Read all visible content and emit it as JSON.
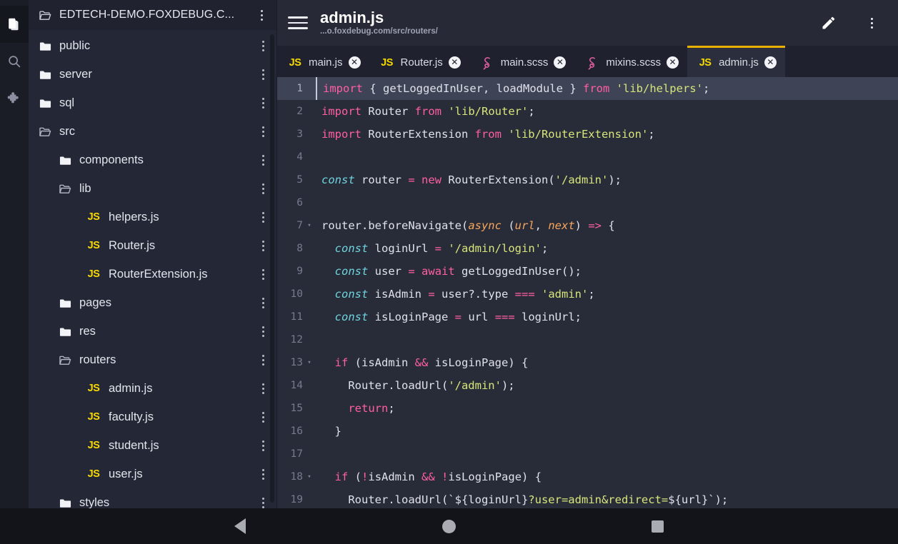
{
  "activity_bar": {
    "items": [
      {
        "name": "files-icon",
        "label": "Files",
        "active": true
      },
      {
        "name": "search-icon",
        "label": "Search",
        "active": false
      },
      {
        "name": "extensions-icon",
        "label": "Extensions",
        "active": false
      }
    ]
  },
  "explorer": {
    "project_name": "EDTECH-DEMO.FOXDEBUG.C...",
    "tree": [
      {
        "label": "public",
        "type": "folder",
        "depth": 1
      },
      {
        "label": "server",
        "type": "folder",
        "depth": 1
      },
      {
        "label": "sql",
        "type": "folder",
        "depth": 1
      },
      {
        "label": "src",
        "type": "folder-open",
        "depth": 1
      },
      {
        "label": "components",
        "type": "folder",
        "depth": 2
      },
      {
        "label": "lib",
        "type": "folder-open",
        "depth": 2
      },
      {
        "label": "helpers.js",
        "type": "js",
        "depth": 3
      },
      {
        "label": "Router.js",
        "type": "js",
        "depth": 3
      },
      {
        "label": "RouterExtension.js",
        "type": "js",
        "depth": 3
      },
      {
        "label": "pages",
        "type": "folder",
        "depth": 2
      },
      {
        "label": "res",
        "type": "folder",
        "depth": 2
      },
      {
        "label": "routers",
        "type": "folder-open",
        "depth": 2
      },
      {
        "label": "admin.js",
        "type": "js",
        "depth": 3
      },
      {
        "label": "faculty.js",
        "type": "js",
        "depth": 3
      },
      {
        "label": "student.js",
        "type": "js",
        "depth": 3
      },
      {
        "label": "user.js",
        "type": "js",
        "depth": 3
      },
      {
        "label": "styles",
        "type": "folder",
        "depth": 2
      }
    ]
  },
  "header": {
    "menu_icon": "hamburger-icon",
    "file_name": "admin.js",
    "file_path": "...o.foxdebug.com/src/routers/",
    "edit_icon": "pencil-icon",
    "overflow_icon": "more-vertical-icon"
  },
  "tabs": [
    {
      "label": "main.js",
      "icon": "js",
      "active": false,
      "close": "✕"
    },
    {
      "label": "Router.js",
      "icon": "js",
      "active": false,
      "close": "✕"
    },
    {
      "label": "main.scss",
      "icon": "scss",
      "active": false,
      "close": "✕"
    },
    {
      "label": "mixins.scss",
      "icon": "scss",
      "active": false,
      "close": "✕"
    },
    {
      "label": "admin.js",
      "icon": "js",
      "active": true,
      "close": "✕"
    }
  ],
  "editor": {
    "active_line": 1,
    "lines": [
      {
        "n": "1",
        "fold": "",
        "cur": true,
        "tokens": [
          {
            "t": "import",
            "c": "k"
          },
          {
            "t": " { ",
            "c": "pl"
          },
          {
            "t": "getLoggedInUser",
            "c": "id"
          },
          {
            "t": ", ",
            "c": "pl"
          },
          {
            "t": "loadModule",
            "c": "id"
          },
          {
            "t": " } ",
            "c": "pl"
          },
          {
            "t": "from",
            "c": "k"
          },
          {
            "t": " ",
            "c": "pl"
          },
          {
            "t": "'lib/helpers'",
            "c": "str"
          },
          {
            "t": ";",
            "c": "pl"
          }
        ]
      },
      {
        "n": "2",
        "fold": "",
        "cur": false,
        "tokens": [
          {
            "t": "import",
            "c": "k"
          },
          {
            "t": " Router ",
            "c": "id"
          },
          {
            "t": "from",
            "c": "k"
          },
          {
            "t": " ",
            "c": "pl"
          },
          {
            "t": "'lib/Router'",
            "c": "str"
          },
          {
            "t": ";",
            "c": "pl"
          }
        ]
      },
      {
        "n": "3",
        "fold": "",
        "cur": false,
        "tokens": [
          {
            "t": "import",
            "c": "k"
          },
          {
            "t": " RouterExtension ",
            "c": "id"
          },
          {
            "t": "from",
            "c": "k"
          },
          {
            "t": " ",
            "c": "pl"
          },
          {
            "t": "'lib/RouterExtension'",
            "c": "str"
          },
          {
            "t": ";",
            "c": "pl"
          }
        ]
      },
      {
        "n": "4",
        "fold": "",
        "cur": false,
        "tokens": []
      },
      {
        "n": "5",
        "fold": "",
        "cur": false,
        "tokens": [
          {
            "t": "const",
            "c": "kw2"
          },
          {
            "t": " router ",
            "c": "id"
          },
          {
            "t": "=",
            "c": "op"
          },
          {
            "t": " ",
            "c": "pl"
          },
          {
            "t": "new",
            "c": "k"
          },
          {
            "t": " RouterExtension(",
            "c": "id"
          },
          {
            "t": "'/admin'",
            "c": "str"
          },
          {
            "t": ");",
            "c": "pl"
          }
        ]
      },
      {
        "n": "6",
        "fold": "",
        "cur": false,
        "tokens": []
      },
      {
        "n": "7",
        "fold": "▾",
        "cur": false,
        "tokens": [
          {
            "t": "router.beforeNavigate(",
            "c": "id"
          },
          {
            "t": "async",
            "c": "par"
          },
          {
            "t": " (",
            "c": "pl"
          },
          {
            "t": "url",
            "c": "par"
          },
          {
            "t": ", ",
            "c": "pl"
          },
          {
            "t": "next",
            "c": "par"
          },
          {
            "t": ") ",
            "c": "pl"
          },
          {
            "t": "=>",
            "c": "op"
          },
          {
            "t": " {",
            "c": "pl"
          }
        ]
      },
      {
        "n": "8",
        "fold": "",
        "cur": false,
        "tokens": [
          {
            "t": "  ",
            "c": "pl"
          },
          {
            "t": "const",
            "c": "kw2"
          },
          {
            "t": " loginUrl ",
            "c": "id"
          },
          {
            "t": "=",
            "c": "op"
          },
          {
            "t": " ",
            "c": "pl"
          },
          {
            "t": "'/admin/login'",
            "c": "str"
          },
          {
            "t": ";",
            "c": "pl"
          }
        ]
      },
      {
        "n": "9",
        "fold": "",
        "cur": false,
        "tokens": [
          {
            "t": "  ",
            "c": "pl"
          },
          {
            "t": "const",
            "c": "kw2"
          },
          {
            "t": " user ",
            "c": "id"
          },
          {
            "t": "=",
            "c": "op"
          },
          {
            "t": " ",
            "c": "pl"
          },
          {
            "t": "await",
            "c": "k"
          },
          {
            "t": " getLoggedInUser();",
            "c": "id"
          }
        ]
      },
      {
        "n": "10",
        "fold": "",
        "cur": false,
        "tokens": [
          {
            "t": "  ",
            "c": "pl"
          },
          {
            "t": "const",
            "c": "kw2"
          },
          {
            "t": " isAdmin ",
            "c": "id"
          },
          {
            "t": "=",
            "c": "op"
          },
          {
            "t": " user?.type ",
            "c": "id"
          },
          {
            "t": "===",
            "c": "op"
          },
          {
            "t": " ",
            "c": "pl"
          },
          {
            "t": "'admin'",
            "c": "str"
          },
          {
            "t": ";",
            "c": "pl"
          }
        ]
      },
      {
        "n": "11",
        "fold": "",
        "cur": false,
        "tokens": [
          {
            "t": "  ",
            "c": "pl"
          },
          {
            "t": "const",
            "c": "kw2"
          },
          {
            "t": " isLoginPage ",
            "c": "id"
          },
          {
            "t": "=",
            "c": "op"
          },
          {
            "t": " url ",
            "c": "id"
          },
          {
            "t": "===",
            "c": "op"
          },
          {
            "t": " loginUrl;",
            "c": "id"
          }
        ]
      },
      {
        "n": "12",
        "fold": "",
        "cur": false,
        "tokens": []
      },
      {
        "n": "13",
        "fold": "▾",
        "cur": false,
        "tokens": [
          {
            "t": "  ",
            "c": "pl"
          },
          {
            "t": "if",
            "c": "k"
          },
          {
            "t": " (isAdmin ",
            "c": "id"
          },
          {
            "t": "&&",
            "c": "op"
          },
          {
            "t": " isLoginPage) {",
            "c": "id"
          }
        ]
      },
      {
        "n": "14",
        "fold": "",
        "cur": false,
        "tokens": [
          {
            "t": "    ",
            "c": "pl"
          },
          {
            "t": "Router.loadUrl(",
            "c": "id"
          },
          {
            "t": "'/admin'",
            "c": "str"
          },
          {
            "t": ");",
            "c": "pl"
          }
        ]
      },
      {
        "n": "15",
        "fold": "",
        "cur": false,
        "tokens": [
          {
            "t": "    ",
            "c": "pl"
          },
          {
            "t": "return",
            "c": "k"
          },
          {
            "t": ";",
            "c": "pl"
          }
        ]
      },
      {
        "n": "16",
        "fold": "",
        "cur": false,
        "tokens": [
          {
            "t": "  }",
            "c": "pl"
          }
        ]
      },
      {
        "n": "17",
        "fold": "",
        "cur": false,
        "tokens": []
      },
      {
        "n": "18",
        "fold": "▾",
        "cur": false,
        "tokens": [
          {
            "t": "  ",
            "c": "pl"
          },
          {
            "t": "if",
            "c": "k"
          },
          {
            "t": " (",
            "c": "pl"
          },
          {
            "t": "!",
            "c": "op"
          },
          {
            "t": "isAdmin ",
            "c": "id"
          },
          {
            "t": "&&",
            "c": "op"
          },
          {
            "t": " ",
            "c": "pl"
          },
          {
            "t": "!",
            "c": "op"
          },
          {
            "t": "isLoginPage) {",
            "c": "id"
          }
        ]
      },
      {
        "n": "19",
        "fold": "",
        "cur": false,
        "tokens": [
          {
            "t": "    ",
            "c": "pl"
          },
          {
            "t": "Router.loadUrl(`",
            "c": "id"
          },
          {
            "t": "${loginUrl}",
            "c": "pl"
          },
          {
            "t": "?user=admin&redirect=",
            "c": "str"
          },
          {
            "t": "${url}",
            "c": "pl"
          },
          {
            "t": "`);",
            "c": "id"
          }
        ]
      }
    ]
  },
  "navbar": {
    "back": "back-triangle-icon",
    "home": "home-circle-icon",
    "recents": "recents-square-icon"
  },
  "colors": {
    "accent": "#e8b100",
    "js_icon": "#f6d800",
    "scss_icon": "#e05fa0",
    "keyword": "#ff5fa2",
    "string": "#d7e67a",
    "param": "#f7a55c",
    "const": "#6fd3e0",
    "editor_bg": "#282c38",
    "sidebar_bg": "#242736"
  }
}
